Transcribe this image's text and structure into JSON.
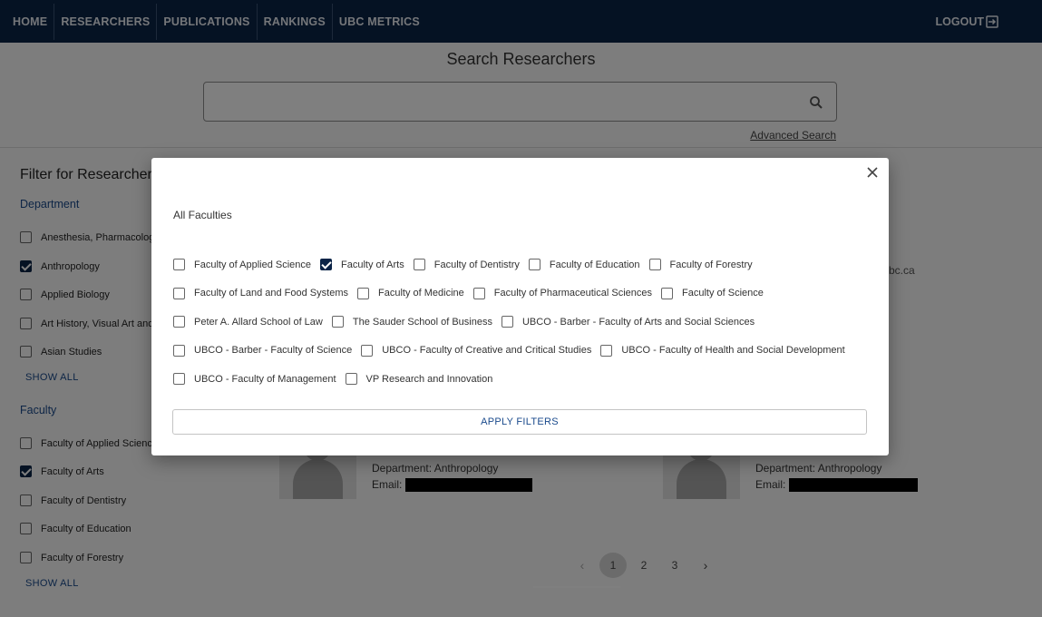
{
  "nav": {
    "items": [
      "HOME",
      "RESEARCHERS",
      "PUBLICATIONS",
      "RANKINGS",
      "UBC METRICS"
    ],
    "logout_label": "LOGOUT"
  },
  "search": {
    "title": "Search Researchers",
    "value": "",
    "advanced_label": "Advanced Search"
  },
  "sidebar": {
    "title": "Filter for Researchers",
    "department_heading": "Department",
    "departments": [
      {
        "label": "Anesthesia, Pharmacology",
        "checked": false
      },
      {
        "label": "Anthropology",
        "checked": true
      },
      {
        "label": "Applied Biology",
        "checked": false
      },
      {
        "label": "Art History, Visual Art and",
        "checked": false
      },
      {
        "label": "Asian Studies",
        "checked": false
      }
    ],
    "show_all_label": "SHOW ALL",
    "faculty_heading": "Faculty",
    "faculties": [
      {
        "label": "Faculty of Applied Science",
        "checked": false
      },
      {
        "label": "Faculty of Arts",
        "checked": true
      },
      {
        "label": "Faculty of Dentistry",
        "checked": false
      },
      {
        "label": "Faculty of Education",
        "checked": false
      },
      {
        "label": "Faculty of Forestry",
        "checked": false
      }
    ]
  },
  "cards": [
    {
      "department": "Department: Anthropology",
      "email_label": "Email:"
    },
    {
      "department": "Department: Anthropology",
      "email_label": "Email:"
    }
  ],
  "partial_texts": {
    "email_suffix": "bc.ca"
  },
  "pagination": {
    "pages": [
      "1",
      "2",
      "3"
    ],
    "current": "1"
  },
  "modal": {
    "title": "All Faculties",
    "rows": [
      [
        {
          "label": "Faculty of Applied Science",
          "checked": false
        },
        {
          "label": "Faculty of Arts",
          "checked": true
        },
        {
          "label": "Faculty of Dentistry",
          "checked": false
        },
        {
          "label": "Faculty of Education",
          "checked": false
        },
        {
          "label": "Faculty of Forestry",
          "checked": false
        }
      ],
      [
        {
          "label": "Faculty of Land and Food Systems",
          "checked": false
        },
        {
          "label": "Faculty of Medicine",
          "checked": false
        },
        {
          "label": "Faculty of Pharmaceutical Sciences",
          "checked": false
        },
        {
          "label": "Faculty of Science",
          "checked": false
        }
      ],
      [
        {
          "label": "Peter A. Allard School of Law",
          "checked": false
        },
        {
          "label": "The Sauder School of Business",
          "checked": false
        },
        {
          "label": "UBCO - Barber - Faculty of Arts and Social Sciences",
          "checked": false
        }
      ],
      [
        {
          "label": "UBCO - Barber - Faculty of Science",
          "checked": false
        },
        {
          "label": "UBCO - Faculty of Creative and Critical Studies",
          "checked": false
        },
        {
          "label": "UBCO - Faculty of Health and Social Development",
          "checked": false
        }
      ],
      [
        {
          "label": "UBCO - Faculty of Management",
          "checked": false
        },
        {
          "label": "VP Research and Innovation",
          "checked": false
        }
      ]
    ],
    "apply_label": "APPLY FILTERS",
    "close_icon": "close-icon"
  },
  "colors": {
    "nav_bg": "#0b2447",
    "accent": "#1a4a8c",
    "check": "#0b2447"
  }
}
